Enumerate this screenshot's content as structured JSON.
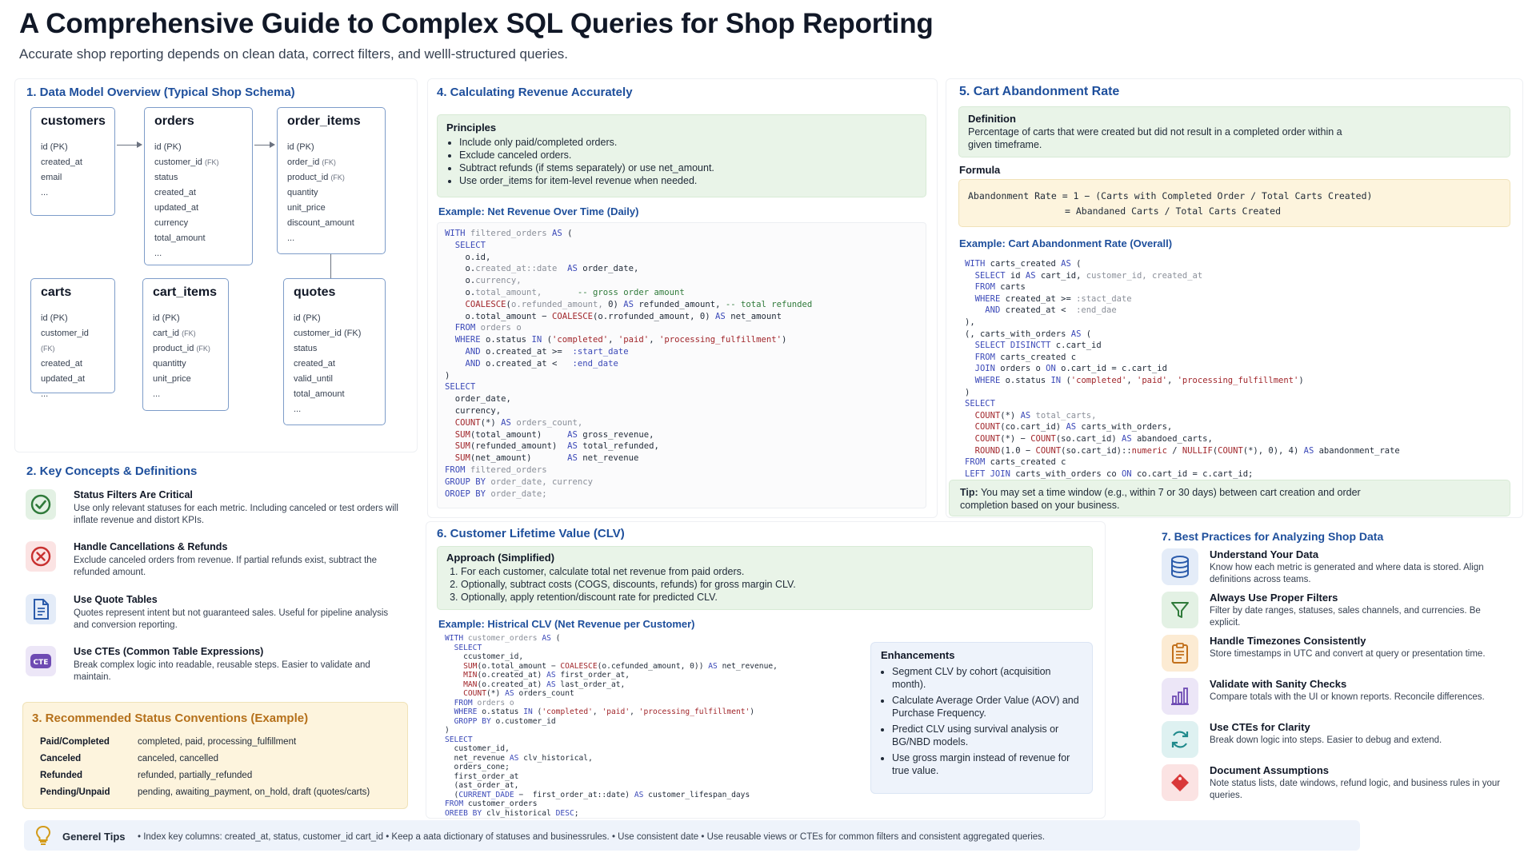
{
  "header": {
    "title": "A Comprehensive Guide to Complex SQL Queries for Shop Reporting",
    "subtitle": "Accurate shop reporting depends on clean data, correct filters, and welll-structured queries."
  },
  "section1": {
    "heading": "1. Data Model Overview (Typical Shop Schema)",
    "tables": [
      {
        "name": "customers",
        "fields": [
          "id (PK)",
          "created_at",
          "email",
          "..."
        ]
      },
      {
        "name": "orders",
        "fields": [
          "id (PK)",
          "customer_id (FK)",
          "status",
          "created_at",
          "updated_at",
          "currency",
          "total_amount",
          "..."
        ]
      },
      {
        "name": "order_items",
        "fields": [
          "id (PK)",
          "order_id (FK)",
          "product_id (FK)",
          "quantity",
          "unit_price",
          "discount_amount",
          "..."
        ]
      },
      {
        "name": "carts",
        "fields": [
          "id (PK)",
          "customer_id (FK)",
          "created_at",
          "updated_at",
          "..."
        ]
      },
      {
        "name": "cart_items",
        "fields": [
          "id (PK)",
          "cart_id (FK)",
          "product_id (FK)",
          "quantitty",
          "unit_price",
          "..."
        ]
      },
      {
        "name": "quotes",
        "fields": [
          "id (PK)",
          "customer_id (FK)",
          "status",
          "created_at",
          "valid_until",
          "total_amount",
          "..."
        ]
      }
    ]
  },
  "section2": {
    "heading": "2. Key Concepts & Definitions",
    "items": [
      {
        "title": "Status Filters Are Critical",
        "desc": "Use only relevant statuses for each metric. Including canceled or test orders will inflate revenue and distort KPIs.",
        "icon": "check-circle-icon"
      },
      {
        "title": "Handle Cancellations & Refunds",
        "desc": "Exclude canceled orders from revenue. If partial refunds exist, subtract the refunded amount.",
        "icon": "x-circle-icon"
      },
      {
        "title": "Use Quote Tables",
        "desc": "Quotes represent intent but not guaranteed sales. Useful for pipeline analysis and conversion reporting.",
        "icon": "document-icon"
      },
      {
        "title": "Use CTEs (Common Table Expressions)",
        "desc": "Break complex logic into readable, reusable steps. Easier to validate and maintain.",
        "icon": "cte-icon"
      }
    ]
  },
  "section3": {
    "heading": "3. Recommended Status Conventions (Example)",
    "rows": [
      {
        "label": "Paid/Completed",
        "value": "completed, paid, processing_fulfillment"
      },
      {
        "label": "Canceled",
        "value": "canceled, cancelled"
      },
      {
        "label": "Refunded",
        "value": "refunded, partially_refunded"
      },
      {
        "label": "Pending/Unpaid",
        "value": "pending, awaiting_payment, on_hold, draft (quotes/carts)"
      }
    ]
  },
  "section4": {
    "heading": "4. Calculating Revenue Accurately",
    "principles_title": "Principles",
    "principles": [
      "Include only paid/completed orders.",
      "Exclude canceled orders.",
      "Subtract refunds (if stems separately) or use net_amount.",
      "Use order_items for item-level revenue when needed."
    ],
    "example_title": "Example: Net Revenue Over Time (Daily)"
  },
  "section5": {
    "heading": "5. Cart Abandonment Rate",
    "definition_title": "Definition",
    "definition_text": "Percentage of carts that were created but did not result in a completed order within a given timeframe.",
    "formula_title": "Formula",
    "formula_line1": "Abandonment Rate = 1 − (Carts with Completed Order / Total Carts Created)",
    "formula_line2": "= Abandaned Carts / Total Carts Created",
    "example_title": "Example: Cart Abandonment Rate (Overall)",
    "tip_label": "Tip:",
    "tip_text": "You may set a time window (e.g., within 7 or 30 days) between cart creation and order completion based on your business."
  },
  "section6": {
    "heading": "6. Customer Lifetime Value (CLV)",
    "approach_title": "Approach (Simplified)",
    "approach": [
      "For each customer, calculate total net revenue from paid orders.",
      "Optionally, subtract costs (COGS, discounts, refunds) for gross margin CLV.",
      "Optionally, apply retention/discount rate for predicted CLV."
    ],
    "example_title": "Example: Histrical CLV (Net Revenue per Customer)",
    "enh_title": "Enhancements",
    "enhancements": [
      "Segment CLV by cohort (acquisition month).",
      "Calculate Average Order Value (AOV) and Purchase Frequency.",
      "Predict CLV using survival analysis or BG/NBD models.",
      "Use gross margin instead of revenue for true value."
    ]
  },
  "section7": {
    "heading": "7. Best Practices for Analyzing Shop Data",
    "items": [
      {
        "title": "Understand Your Data",
        "desc": "Know how each metric is generated and where data is stored. Align definitions across teams.",
        "icon": "database-icon"
      },
      {
        "title": "Always Use Proper Filters",
        "desc": "Filter by date ranges, statuses, sales channels, and currencies. Be explicit.",
        "icon": "filter-icon"
      },
      {
        "title": "Handle Timezones Consistently",
        "desc": "Store timestamps in UTC and convert at query or presentation time.",
        "icon": "clipboard-icon"
      },
      {
        "title": "Validate with Sanity Checks",
        "desc": "Compare totals with the UI or known reports. Reconcile differences.",
        "icon": "bar-chart-icon"
      },
      {
        "title": "Use CTEs for Clarity",
        "desc": "Break down logic into steps. Easier to debug and extend.",
        "icon": "refresh-icon"
      },
      {
        "title": "Document Assumptions",
        "desc": "Note status lists, date windows, refund logic, and business rules in your queries.",
        "icon": "tag-icon"
      }
    ]
  },
  "footer": {
    "label": "Generel Tips",
    "tips": "• Index key columns: created_at, status, customer_id cart_id • Keep a aata dictionary of statuses and businessrules. • Use consistent date • Use reusable views or CTEs for common filters and consistent aggregated queries."
  },
  "colors": {
    "accent_blue": "#1e4f9c",
    "green_panel": "#e9f4e8",
    "yellow_panel": "#fdf4dd"
  }
}
